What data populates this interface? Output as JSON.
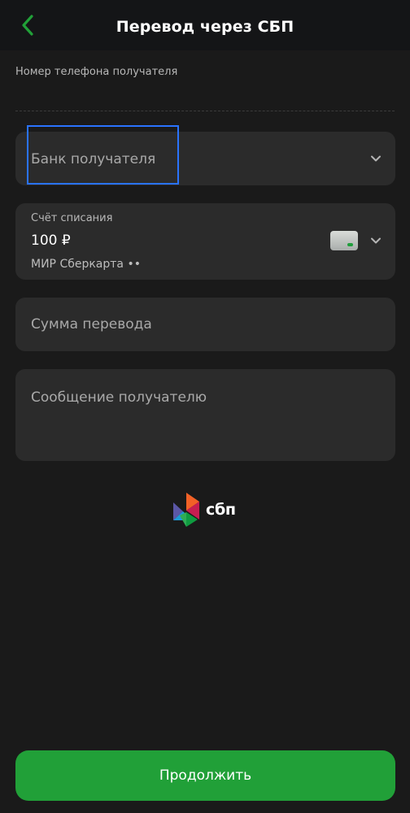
{
  "header": {
    "title": "Перевод через СБП",
    "back_icon": "chevron-left-icon",
    "accent_color": "#21a038"
  },
  "phone": {
    "label": "Номер телефона получателя",
    "value": ""
  },
  "bank": {
    "placeholder": "Банк получателя",
    "focused": true,
    "focus_color": "#2a73ff"
  },
  "account": {
    "caption": "Счёт списания",
    "balance": "100 ₽",
    "card_name": "МИР Сберкарта ••",
    "card_icon": "bank-card-icon"
  },
  "amount": {
    "placeholder": "Сумма перевода"
  },
  "message": {
    "placeholder": "Сообщение получателю"
  },
  "sbp": {
    "logo_text": "сбп"
  },
  "actions": {
    "continue_label": "Продолжить",
    "continue_color": "#21a038"
  }
}
